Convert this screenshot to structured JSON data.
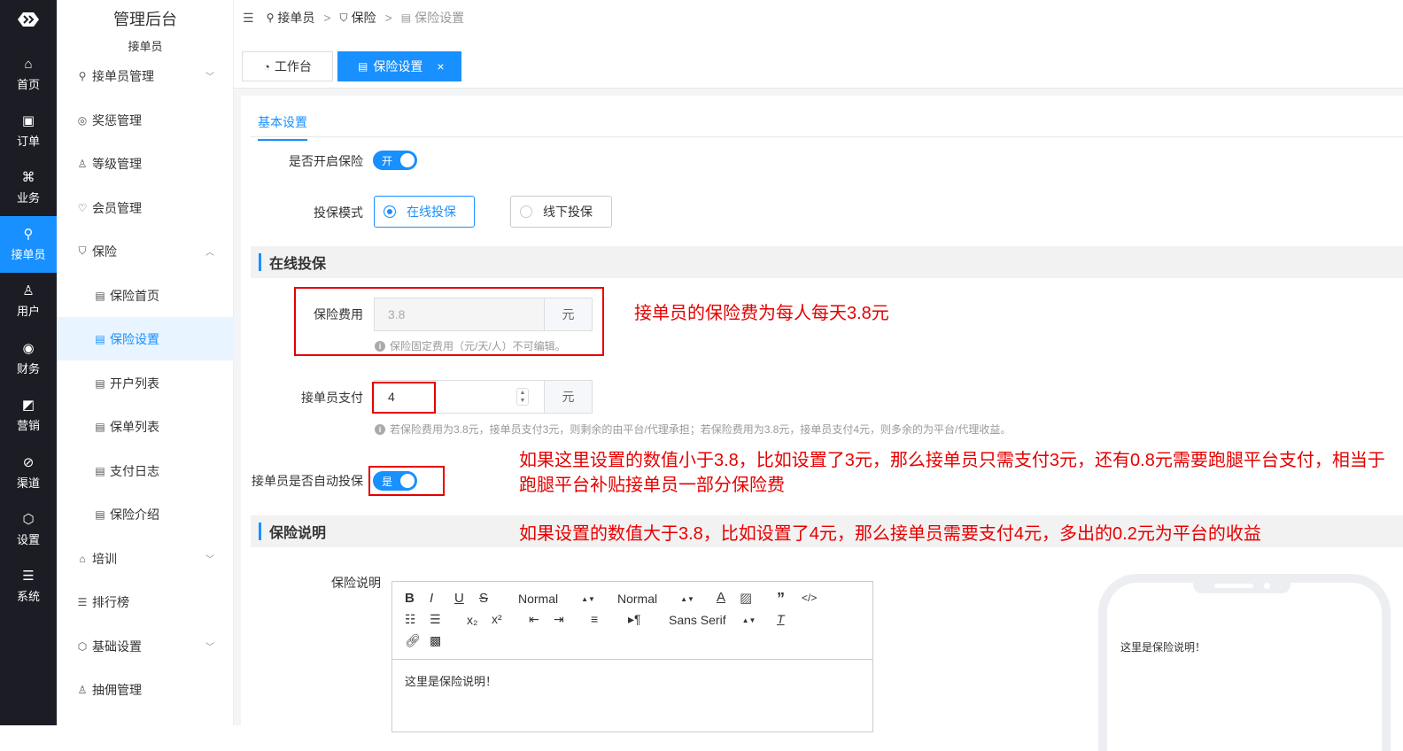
{
  "rail": {
    "items": [
      {
        "label": "首页",
        "icon": "home-icon"
      },
      {
        "label": "订单",
        "icon": "order-icon"
      },
      {
        "label": "业务",
        "icon": "business-icon"
      },
      {
        "label": "接单员",
        "icon": "bike-icon"
      },
      {
        "label": "用户",
        "icon": "user-icon"
      },
      {
        "label": "财务",
        "icon": "finance-icon"
      },
      {
        "label": "营销",
        "icon": "marketing-icon"
      },
      {
        "label": "渠道",
        "icon": "channel-icon"
      },
      {
        "label": "设置",
        "icon": "settings-icon"
      },
      {
        "label": "系统",
        "icon": "system-icon"
      }
    ],
    "active_index": 3
  },
  "menu": {
    "title": "管理后台",
    "subtitle": "接单员",
    "items": [
      {
        "label": "接单员管理"
      },
      {
        "label": "奖惩管理"
      },
      {
        "label": "等级管理"
      },
      {
        "label": "会员管理"
      },
      {
        "label": "保险"
      },
      {
        "label": "保险首页"
      },
      {
        "label": "保险设置"
      },
      {
        "label": "开户列表"
      },
      {
        "label": "保单列表"
      },
      {
        "label": "支付日志"
      },
      {
        "label": "保险介绍"
      },
      {
        "label": "培训"
      },
      {
        "label": "排行榜"
      },
      {
        "label": "基础设置"
      },
      {
        "label": "抽佣管理"
      }
    ]
  },
  "breadcrumb": {
    "items": [
      "接单员",
      "保险",
      "保险设置"
    ]
  },
  "tabs": {
    "workbench": "工作台",
    "insurance_settings": "保险设置",
    "close": "×"
  },
  "form": {
    "tab_label": "基本设置",
    "enable_label": "是否开启保险",
    "enable_value": "开",
    "mode_label": "投保模式",
    "mode_online": "在线投保",
    "mode_offline": "线下投保",
    "section_online": "在线投保",
    "fee_label": "保险费用",
    "fee_value": "3.8",
    "unit": "元",
    "fee_tip": "保险固定费用（元/天/人）不可编辑。",
    "pay_label": "接单员支付",
    "pay_value": "4",
    "pay_tip": "若保险费用为3.8元，接单员支付3元，则剩余的由平台/代理承担；若保险费用为3.8元，接单员支付4元，则多余的为平台/代理收益。",
    "auto_label": "接单员是否自动投保",
    "auto_value": "是",
    "section_desc": "保险说明",
    "desc_label": "保险说明",
    "editor_header": "Normal",
    "editor_size": "Normal",
    "editor_font": "Sans Serif",
    "editor_text": "这里是保险说明！",
    "preview_text": "这里是保险说明！"
  },
  "annotations": {
    "fee_note": "接单员的保险费为每人每天3.8元",
    "less_note": "如果这里设置的数值小于3.8，比如设置了3元，那么接单员只需支付3元，还有0.8元需要跑腿平台支付，相当于跑腿平台补贴接单员一部分保险费",
    "more_note": "如果设置的数值大于3.8，比如设置了4元，那么接单员需要支付4元，多出的0.2元为平台的收益"
  },
  "colors": {
    "primary": "#1890ff",
    "annotation": "#e60000",
    "rail_bg": "#1c1d24"
  }
}
